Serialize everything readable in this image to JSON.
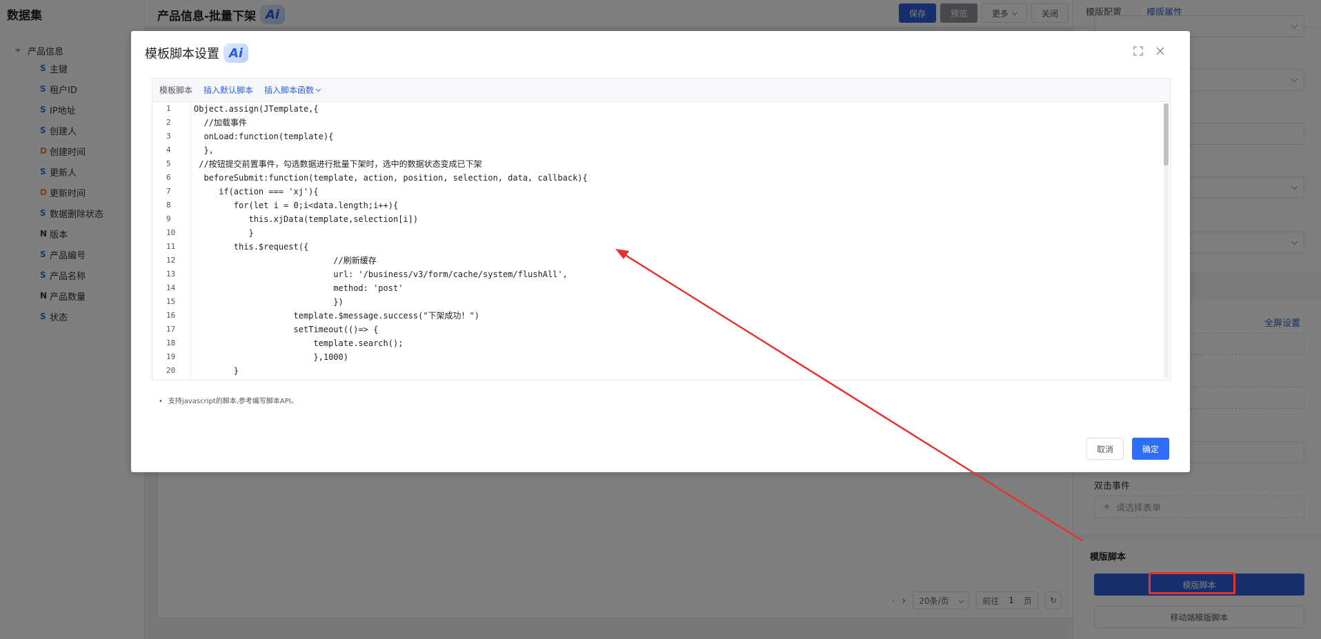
{
  "app": {
    "dataset_title": "数据集",
    "page_title": "产品信息-批量下架",
    "ai_label": "Ai"
  },
  "toolbar": {
    "save": "保存",
    "preview": "预览",
    "more": "更多",
    "close": "关闭"
  },
  "tree": {
    "root": "产品信息",
    "items": [
      {
        "type": "S",
        "label": "主键"
      },
      {
        "type": "S",
        "label": "租户ID"
      },
      {
        "type": "S",
        "label": "IP地址"
      },
      {
        "type": "S",
        "label": "创建人"
      },
      {
        "type": "D",
        "label": "创建时间"
      },
      {
        "type": "S",
        "label": "更新人"
      },
      {
        "type": "D",
        "label": "更新时间"
      },
      {
        "type": "S",
        "label": "数据删除状态"
      },
      {
        "type": "N",
        "label": "版本"
      },
      {
        "type": "S",
        "label": "产品编号"
      },
      {
        "type": "S",
        "label": "产品名称"
      },
      {
        "type": "N",
        "label": "产品数量"
      },
      {
        "type": "S",
        "label": "状态"
      }
    ]
  },
  "right_panel": {
    "tabs": [
      "模版配置",
      "模版属性"
    ],
    "active_tab": 1,
    "fullscreen_link": "全屏设置",
    "double_click_label": "双击事件",
    "select_form_placeholder": "请选择表单",
    "script_section_title": "模版脚本",
    "script_button": "模版脚本",
    "mobile_script_button": "移动端模版脚本"
  },
  "pager": {
    "page_size": "20条/页",
    "goto_label": "前往",
    "page_number": "1",
    "page_unit": "页"
  },
  "dialog": {
    "title": "模板脚本设置",
    "editor_label": "模板脚本",
    "insert_default": "插入默认脚本",
    "insert_function": "插入脚本函数",
    "code_lines": [
      "Object.assign(JTemplate,{",
      "  //加载事件",
      "  onLoad:function(template){",
      "  },",
      " //按钮提交前置事件，勾选数据进行批量下架时，选中的数据状态变成已下架",
      "  beforeSubmit:function(template, action, position, selection, data, callback){",
      "     if(action === 'xj'){",
      "        for(let i = 0;i<data.length;i++){",
      "           this.xjData(template,selection[i])",
      "           }",
      "        this.$request({",
      "                            //刷新缓存",
      "                            url: '/business/v3/form/cache/system/flushAll',",
      "                            method: 'post'",
      "                            })",
      "                    template.$message.success(\"下架成功！\")",
      "                    setTimeout(()=> {",
      "                        template.search();",
      "                        },1000)",
      "        }"
    ],
    "hint": "支持javascript的脚本,参考编写脚本API。",
    "cancel": "取消",
    "confirm": "确定"
  },
  "colors": {
    "primary": "#2f5fd8",
    "annotation": "#e8322f"
  }
}
